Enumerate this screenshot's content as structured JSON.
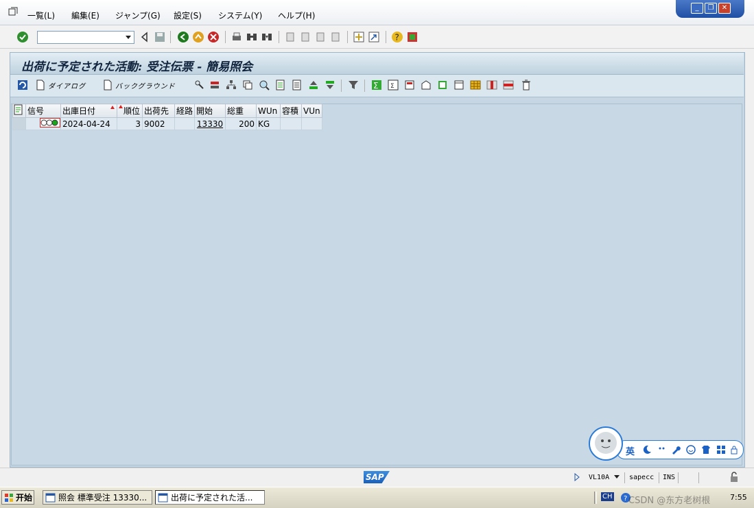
{
  "menu": {
    "items": [
      "一覧(L)",
      "編集(E)",
      "ジャンプ(G)",
      "設定(S)",
      "システム(Y)",
      "ヘルプ(H)"
    ]
  },
  "window_controls": {
    "minimize": "_",
    "restore": "❐",
    "close": "✕"
  },
  "toolbar": {
    "command_field_value": ""
  },
  "screen": {
    "title": "出荷に予定された活動: 受注伝票 - 簡易照会"
  },
  "app_toolbar": {
    "dialog_label": "ダイアログ",
    "background_label": "バックグラウンド"
  },
  "table": {
    "headers": [
      "信号",
      "出庫日付",
      "順位",
      "出荷先",
      "経路",
      "開始",
      "総重",
      "WUn",
      "容積",
      "VUn"
    ],
    "rows": [
      {
        "date": "2024-04-24",
        "priority": "3",
        "ship_to": "9002",
        "route": "",
        "start": "13330",
        "weight": "200",
        "wun": "KG",
        "volume": "",
        "vun": ""
      }
    ]
  },
  "status": {
    "logo": "SAP",
    "transaction": "VL10A",
    "system": "sapecc",
    "mode": "INS"
  },
  "ime": {
    "lang": "英"
  },
  "taskbar": {
    "start": "开始",
    "buttons": [
      "照会 標準受注 13330...",
      "出荷に予定された活..."
    ],
    "lang": "CH",
    "watermark": "CSDN @东方老树根",
    "time": "7:55"
  },
  "colors": {
    "accent_blue": "#2458a6",
    "signal_red": "#d22222",
    "signal_green": "#1aa51a",
    "sap_blue": "#1a73c8"
  }
}
